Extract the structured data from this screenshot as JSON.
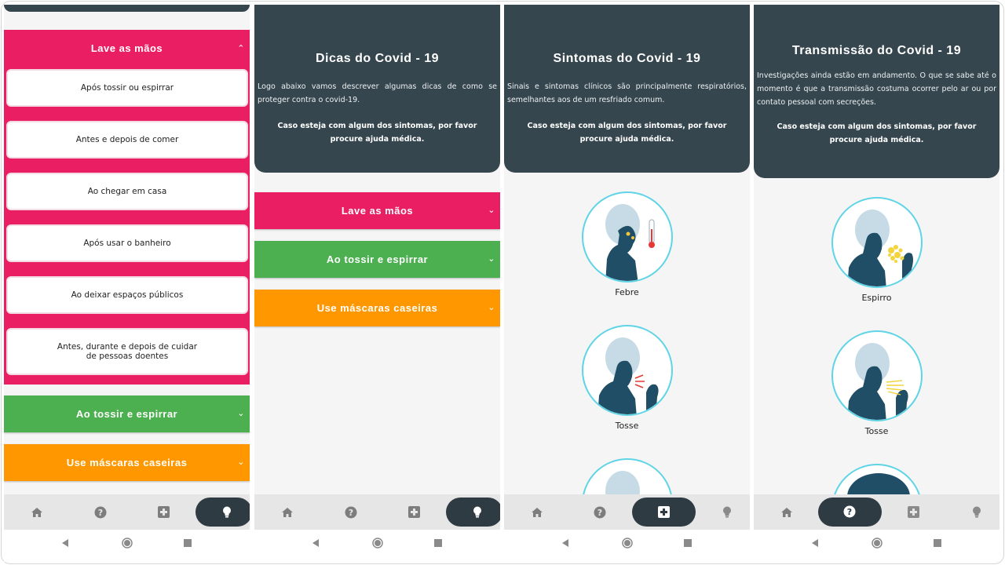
{
  "screen1": {
    "expanded_section": {
      "title": "Lave as mãos",
      "items": [
        "Após tossir ou espirrar",
        "Antes e depois de comer",
        "Ao chegar em casa",
        "Após usar o banheiro",
        "Ao deixar espaços públicos",
        "Antes, durante e depois de cuidar de pessoas doentes"
      ]
    },
    "sections": [
      "Ao tossir e espirrar",
      "Use máscaras caseiras"
    ]
  },
  "screen2": {
    "title": "Dicas do Covid - 19",
    "description": "Logo abaixo vamos descrever algumas dicas de como se proteger contra o covid-19.",
    "warning": "Caso esteja com algum dos sintomas, por favor procure ajuda médica.",
    "sections": [
      "Lave as mãos",
      "Ao tossir e espirrar",
      "Use máscaras caseiras"
    ]
  },
  "screen3": {
    "title": "Sintomas do Covid - 19",
    "description": "Sinais e sintomas clínicos são principalmente respiratórios, semelhantes aos de um resfriado comum.",
    "warning": "Caso esteja com algum dos sintomas, por favor procure ajuda médica.",
    "symptoms": [
      "Febre",
      "Tosse"
    ]
  },
  "screen4": {
    "title": "Transmissão do Covid - 19",
    "description": "Investigações ainda estão em andamento. O que se sabe até o momento é que a transmissão costuma ocorrer pelo ar ou por contato pessoal com secreções.",
    "warning": "Caso esteja com algum dos sintomas, por favor procure ajuda médica.",
    "forms": [
      "Espirro",
      "Tosse"
    ]
  },
  "nav_icons": [
    "home-icon",
    "help-icon",
    "medical-plus-icon",
    "lightbulb-icon"
  ],
  "colors": {
    "dark": "#36464e",
    "pink": "#e91e63",
    "green": "#4caf50",
    "orange": "#ff9800",
    "accent_cyan": "#5ed4e6"
  }
}
